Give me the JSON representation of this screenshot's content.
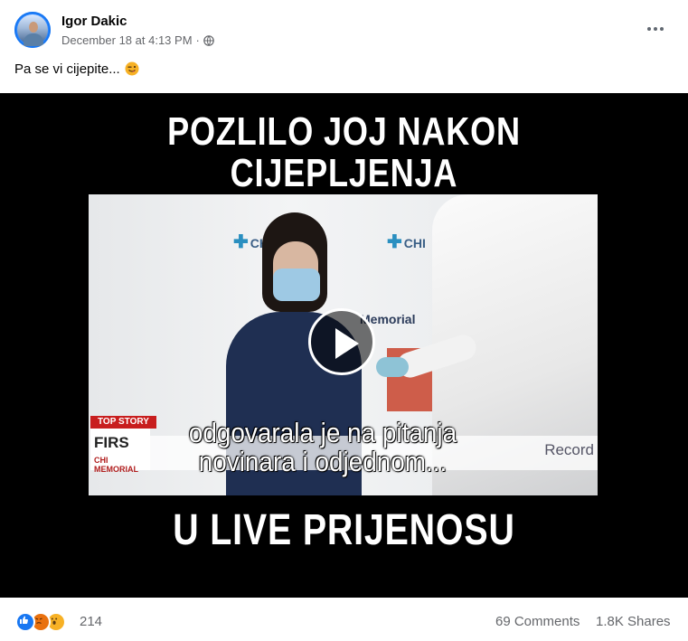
{
  "post": {
    "author": "Igor Dakic",
    "timestamp": "December 18 at 4:13 PM",
    "separator": "·",
    "privacy_icon": "globe-icon",
    "caption": "Pa se vi cijepite...",
    "caption_emoji": "wink-tongue-emoji"
  },
  "video": {
    "headline_top_1": "POZLILO JOJ NAKON",
    "headline_top_2": "CIJEPLJENJA",
    "headline_bottom": "U LIVE PRIJENOSU",
    "subtitle_line_1": "odgovarala je na pitanja",
    "subtitle_line_2": "novinara i odjednom...",
    "top_story_label": "TOP STORY",
    "lower_third_title": "FIRS",
    "lower_third_sub": "CHI MEMORIAL",
    "lower_third_right": "Record",
    "sign_1": "CHI",
    "sign_2": "CHI",
    "sign_3": "Memorial",
    "play_icon": "play-icon"
  },
  "footer": {
    "reactions": [
      "like",
      "angry",
      "wow"
    ],
    "reaction_count": "214",
    "comments": "69 Comments",
    "shares": "1.8K Shares"
  },
  "colors": {
    "author_text": "#050505",
    "meta_text": "#65676b",
    "like_blue": "#1877f2",
    "angry_orange": "#e9710f",
    "wow_yellow": "#f7b125",
    "video_background": "#000000"
  }
}
